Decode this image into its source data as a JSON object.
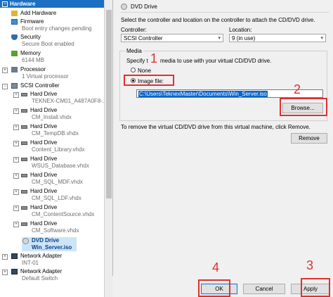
{
  "tree": {
    "category": "Hardware",
    "items": [
      {
        "label": "Add Hardware",
        "sub": ""
      },
      {
        "label": "Firmware",
        "sub": "Boot entry changes pending"
      },
      {
        "label": "Security",
        "sub": "Secure Boot enabled"
      },
      {
        "label": "Memory",
        "sub": "6144 MB"
      },
      {
        "label": "Processor",
        "sub": "1 Virtual processor"
      },
      {
        "label": "SCSI Controller",
        "sub": ""
      },
      {
        "label": "Hard Drive",
        "sub": "TEKNEX-CM01_A487A0F8-..."
      },
      {
        "label": "Hard Drive",
        "sub": "CM_Install.vhdx"
      },
      {
        "label": "Hard Drive",
        "sub": "CM_TempDB.vhdx"
      },
      {
        "label": "Hard Drive",
        "sub": "Content_Library.vhdx"
      },
      {
        "label": "Hard Drive",
        "sub": "WSUS_Database.vhdx"
      },
      {
        "label": "Hard Drive",
        "sub": "CM_SQL_MDF.vhdx"
      },
      {
        "label": "Hard Drive",
        "sub": "CM_SQL_LDF.vhdx"
      },
      {
        "label": "Hard Drive",
        "sub": "CM_ContentSource.vhdx"
      },
      {
        "label": "Hard Drive",
        "sub": "CM_Software.vhdx"
      },
      {
        "label": "DVD Drive",
        "sub": "Win_Server.iso"
      },
      {
        "label": "Network Adapter",
        "sub": "INT-01"
      },
      {
        "label": "Network Adapter",
        "sub": "Default Switch"
      }
    ]
  },
  "panel": {
    "title": "DVD Drive",
    "description": "Select the controller and location on the controller to attach the CD/DVD drive.",
    "controller_label": "Controller:",
    "controller_value": "SCSI Controller",
    "location_label": "Location:",
    "location_value": "9 (in use)",
    "media_label": "Media",
    "media_specify_a": "Specify t",
    "media_specify_b": "media to use with your virtual CD/DVD drive.",
    "none_label": "None",
    "image_label": "Image file:",
    "image_path": "C:\\Users\\TeknexMaster\\Documents\\Win_Server.iso",
    "browse_label": "Browse...",
    "remove_text": "To remove the virtual CD/DVD drive from this virtual machine, click Remove.",
    "remove_label": "Remove"
  },
  "footer": {
    "ok_label": "OK",
    "cancel_label": "Cancel",
    "apply_label": "Apply"
  },
  "callouts": [
    "1",
    "2",
    "3",
    "4"
  ],
  "colors": {
    "accent": "#1d6fc2",
    "highlight": "#e03030"
  }
}
